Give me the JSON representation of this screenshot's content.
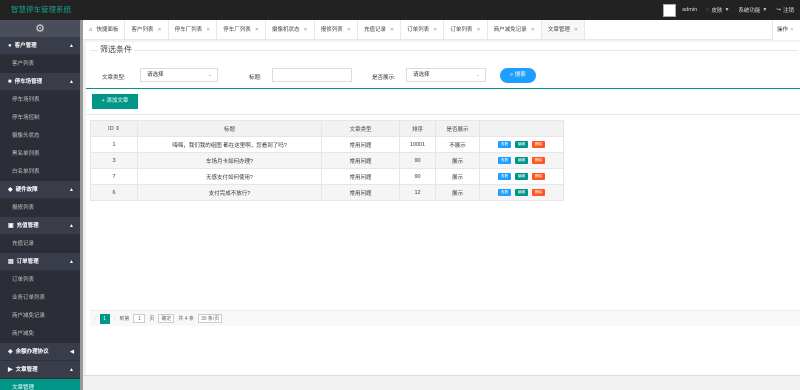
{
  "app": {
    "title": "智慧停车管理系统"
  },
  "topbar": {
    "username": "admin",
    "skin_label": "皮肤",
    "system_label": "系统功能",
    "logout_label": "注销"
  },
  "sidebar": {
    "groups": [
      {
        "label": "客户管理",
        "items": [
          "客户列表"
        ]
      },
      {
        "label": "停车场管理",
        "items": [
          "停车场列表",
          "停车场控制",
          "摄像头状态",
          "黑名单列表",
          "白名单列表"
        ]
      },
      {
        "label": "硬件故障",
        "items": [
          "报修列表"
        ]
      },
      {
        "label": "充值管理",
        "items": [
          "充值记录"
        ]
      },
      {
        "label": "订单管理",
        "items": [
          "订单列表",
          "业务订单列表",
          "商户减免记录",
          "商户减免"
        ]
      },
      {
        "label": "余额办理协议",
        "items": []
      },
      {
        "label": "文章管理",
        "items": [
          "文章管理"
        ]
      }
    ]
  },
  "tabs": [
    "快捷面板",
    "客户列表",
    "停车厂列表",
    "停车厂列表",
    "摄像机状态",
    "报修列表",
    "充值记录",
    "订单列表",
    "订单列表",
    "商户减免记录",
    "文章管理"
  ],
  "ops_label": "操作",
  "filter": {
    "legend": "筛选条件",
    "type_label": "文章类型:",
    "type_value": "请选择",
    "title_label": "标题:",
    "title_value": "",
    "show_label": "是否展示:",
    "show_value": "请选择",
    "search_label": "搜索"
  },
  "add_button": "添加文章",
  "table": {
    "headers": [
      "ID",
      "标题",
      "文章类型",
      "排序",
      "是否展示",
      ""
    ],
    "rows": [
      {
        "id": "1",
        "title": "嗨嗨，我们我的组图 都在这里啊，您看到了吗?",
        "type": "常用问题",
        "sort": "10001",
        "show": "不展示"
      },
      {
        "id": "3",
        "title": "车场月卡如何办理?",
        "type": "常用问题",
        "sort": "90",
        "show": "展示"
      },
      {
        "id": "7",
        "title": "无感支付如何使用?",
        "type": "常用问题",
        "sort": "90",
        "show": "展示"
      },
      {
        "id": "6",
        "title": "支付完成不放行?",
        "type": "常用问题",
        "sort": "12",
        "show": "展示"
      }
    ],
    "actions": {
      "view": "查看",
      "edit": "编辑",
      "delete": "删除"
    }
  },
  "pager": {
    "current": "1",
    "goto_label": "到第",
    "page_input": "1",
    "page_unit": "页",
    "confirm": "确定",
    "total": "共 4 条",
    "size": "30 条/页"
  },
  "colors": {
    "accent": "#009688",
    "sidebar": "#393d49",
    "topbar": "#222222",
    "primary": "#1e9fff",
    "danger": "#ff5722"
  }
}
